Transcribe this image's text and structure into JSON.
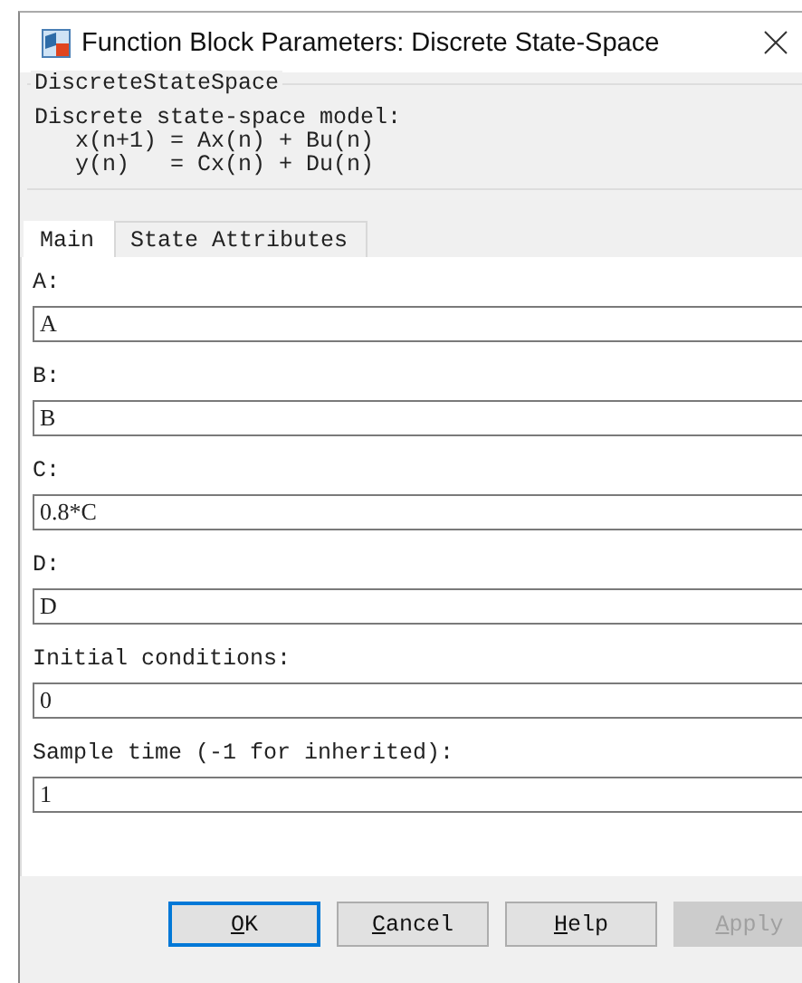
{
  "window": {
    "title": "Function Block Parameters: Discrete State-Space"
  },
  "group": {
    "title": "DiscreteStateSpace",
    "description": "Discrete state-space model:\n   x(n+1) = Ax(n) + Bu(n)\n   y(n)   = Cx(n) + Du(n)"
  },
  "tabs": [
    {
      "label": "Main",
      "selected": true
    },
    {
      "label": "State Attributes",
      "selected": false
    }
  ],
  "parameters": [
    {
      "label": "A:",
      "value": "A"
    },
    {
      "label": "B:",
      "value": "B"
    },
    {
      "label": "C:",
      "value": "0.8*C"
    },
    {
      "label": "D:",
      "value": "D"
    },
    {
      "label": "Initial conditions:",
      "value": "0"
    },
    {
      "label": "Sample time (-1 for inherited):",
      "value": "1"
    }
  ],
  "buttons": [
    {
      "label": "OK",
      "default": true,
      "disabled": false
    },
    {
      "label": "Cancel",
      "default": false,
      "disabled": false
    },
    {
      "label": "Help",
      "default": false,
      "disabled": false
    },
    {
      "label": "Apply",
      "default": false,
      "disabled": true
    }
  ]
}
